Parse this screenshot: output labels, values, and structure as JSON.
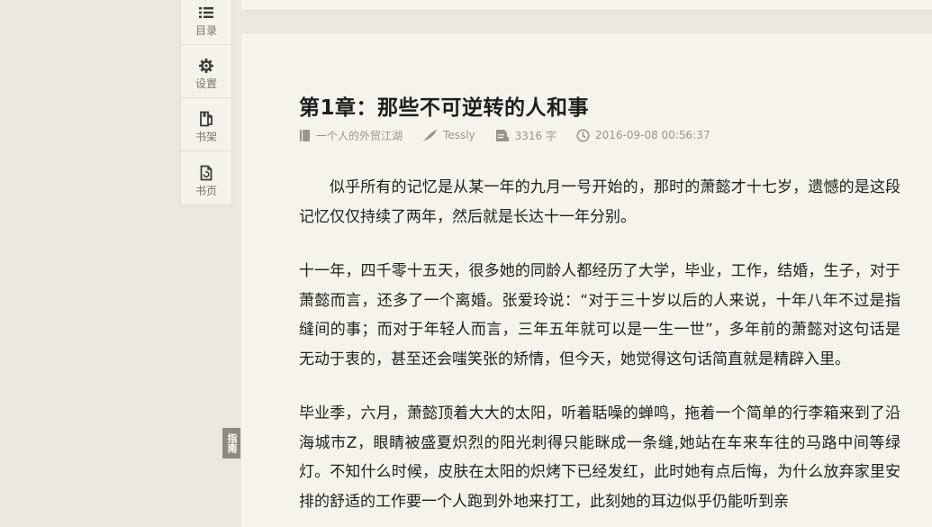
{
  "sidebar": {
    "items": [
      {
        "label": "目录",
        "icon": "list-icon"
      },
      {
        "label": "设置",
        "icon": "gear-icon"
      },
      {
        "label": "书架",
        "icon": "bookshelf-icon"
      },
      {
        "label": "书页",
        "icon": "book-page-icon"
      }
    ]
  },
  "guide_tab": {
    "label": "指南"
  },
  "chapter": {
    "title": "第1章：那些不可逆转的人和事",
    "book": "一个人的外贸江湖",
    "author": "Tessly",
    "word_count": "3316 字",
    "datetime": "2016-09-08 00:56:37"
  },
  "paragraphs": [
    "似乎所有的记忆是从某一年的九月一号开始的，那时的萧懿才十七岁，遗憾的是这段记忆仅仅持续了两年，然后就是长达十一年分别。",
    "十一年，四千零十五天，很多她的同龄人都经历了大学，毕业，工作，结婚，生子，对于萧懿而言，还多了一个离婚。张爱玲说：“对于三十岁以后的人来说，十年八年不过是指缝间的事；而对于年轻人而言，三年五年就可以是一生一世”，多年前的萧懿对这句话是无动于衷的，甚至还会嗤笑张的矫情，但今天，她觉得这句话简直就是精辟入里。",
    "毕业季，六月，萧懿顶着大大的太阳，听着聒噪的蝉鸣，拖着一个简单的行李箱来到了沿海城市Z，眼睛被盛夏炽烈的阳光刺得只能眯成一条缝,她站在车来车往的马路中间等绿灯。不知什么时候，皮肤在太阳的炽烤下已经发红，此时她有点后悔，为什么放弃家里安排的舒适的工作要一个人跑到外地来打工，此刻她的耳边似乎仍能听到亲"
  ]
}
